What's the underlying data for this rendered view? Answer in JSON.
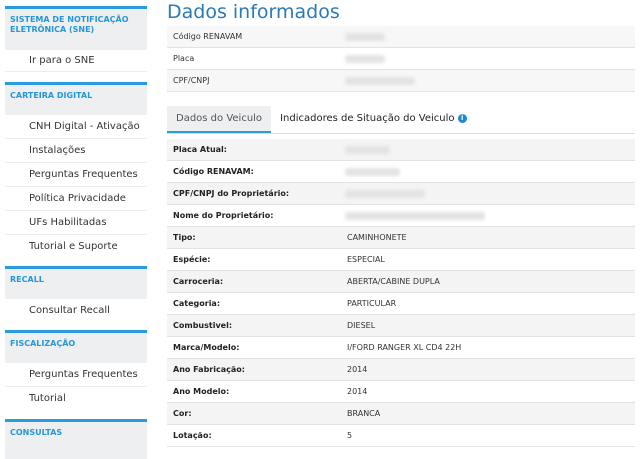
{
  "sidebar": {
    "sections": [
      {
        "title": "SISTEMA DE NOTIFICAÇÃO ELETRÔNICA (SNE)",
        "items": [
          "Ir para o SNE"
        ]
      },
      {
        "title": "CARTEIRA DIGITAL",
        "items": [
          "CNH Digital - Ativação",
          "Instalações",
          "Perguntas Frequentes",
          "Política Privacidade",
          "UFs Habilitadas",
          "Tutorial e Suporte"
        ]
      },
      {
        "title": "RECALL",
        "items": [
          "Consultar Recall"
        ]
      },
      {
        "title": "FISCALIZAÇÃO",
        "items": [
          "Perguntas Frequentes",
          "Tutorial"
        ]
      },
      {
        "title": "CONSULTAS",
        "items": []
      }
    ]
  },
  "main": {
    "title": "Dados informados",
    "info": [
      "Código RENAVAM",
      "Placa",
      "CPF/CNPJ"
    ],
    "tabs": [
      "Dados do Veiculo",
      "Indicadores de Situação do Veiculo"
    ],
    "info_icon": "i",
    "rows": [
      {
        "k": "Placa Atual:",
        "v": ""
      },
      {
        "k": "Código RENAVAM:",
        "v": ""
      },
      {
        "k": "CPF/CNPJ do Proprietário:",
        "v": ""
      },
      {
        "k": "Nome do Proprietário:",
        "v": ""
      },
      {
        "k": "Tipo:",
        "v": "CAMINHONETE"
      },
      {
        "k": "Espécie:",
        "v": "ESPECIAL"
      },
      {
        "k": "Carroceria:",
        "v": "ABERTA/CABINE DUPLA"
      },
      {
        "k": "Categoria:",
        "v": "PARTICULAR"
      },
      {
        "k": "Combustivel:",
        "v": "DIESEL"
      },
      {
        "k": "Marca/Modelo:",
        "v": "I/FORD RANGER XL CD4 22H"
      },
      {
        "k": "Ano Fabricação:",
        "v": "2014"
      },
      {
        "k": "Ano Modelo:",
        "v": "2014"
      },
      {
        "k": "Cor:",
        "v": "BRANCA"
      },
      {
        "k": "Lotação:",
        "v": "5"
      }
    ]
  }
}
